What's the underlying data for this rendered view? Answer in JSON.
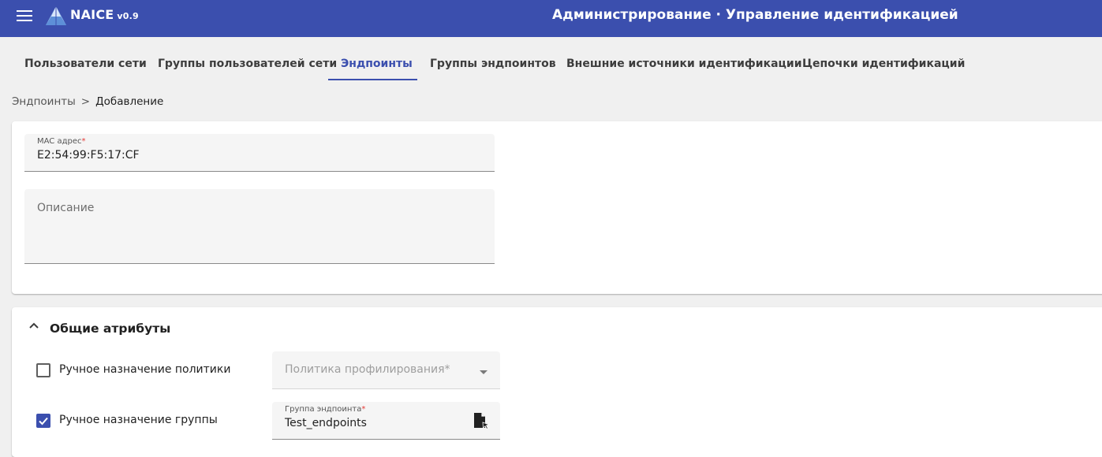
{
  "header": {
    "app_name": "NAICE",
    "version": "v0.9",
    "page_title": "Администрирование · Управление идентификацией",
    "colors": {
      "primary": "#3b4fae",
      "required": "#e53935"
    }
  },
  "tabs": [
    {
      "label": "Пользователи сети",
      "active": false
    },
    {
      "label": "Группы пользователей сети",
      "active": false
    },
    {
      "label": "Эндпоинты",
      "active": true
    },
    {
      "label": "Группы эндпоинтов",
      "active": false
    },
    {
      "label": "Внешние источники идентификации",
      "active": false
    },
    {
      "label": "Цепочки идентификаций",
      "active": false
    }
  ],
  "breadcrumb": {
    "parent": "Эндпоинты",
    "separator": ">",
    "current": "Добавление"
  },
  "form": {
    "mac": {
      "label": "MAC адрес",
      "required_mark": "*",
      "value": "E2:54:99:F5:17:CF"
    },
    "description": {
      "placeholder": "Описание",
      "value": ""
    }
  },
  "attributes": {
    "title": "Общие атрибуты",
    "toggle_icon": "chevron-up-icon",
    "manual_policy": {
      "label": "Ручное назначение политики",
      "checked": false,
      "select_placeholder": "Политика профилирования*"
    },
    "manual_group": {
      "label": "Ручное назначение группы",
      "checked": true,
      "field_label": "Группа эндпоинта",
      "required_mark": "*",
      "value": "Test_endpoints",
      "picker_icon": "file-select-icon"
    }
  }
}
